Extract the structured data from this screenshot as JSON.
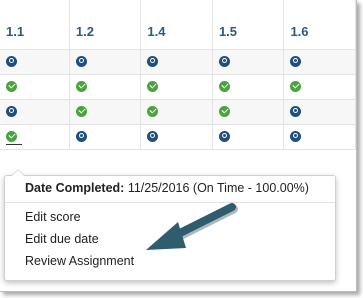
{
  "columns": [
    "1.1",
    "1.2",
    "1.4",
    "1.5",
    "1.6"
  ],
  "rows": [
    [
      "pending",
      "pending",
      "pending",
      "pending",
      "pending"
    ],
    [
      "complete",
      "complete",
      "complete",
      "complete",
      "complete"
    ],
    [
      "pending",
      "complete",
      "complete",
      "complete",
      "pending"
    ],
    [
      "complete",
      "pending",
      "pending",
      "pending",
      "pending"
    ]
  ],
  "popup": {
    "date_label": "Date Completed:",
    "date_value": "11/25/2016 (On Time - 100.00%)",
    "items": [
      "Edit score",
      "Edit due date",
      "Review Assignment"
    ]
  },
  "colors": {
    "header_text": "#2a5b86",
    "pending_icon": "#1f4f7d",
    "complete_icon": "#4aa43d",
    "arrow": "#2f5d6e"
  },
  "icons": {
    "pending": "pending-status-icon",
    "complete": "complete-checkmark-icon"
  }
}
